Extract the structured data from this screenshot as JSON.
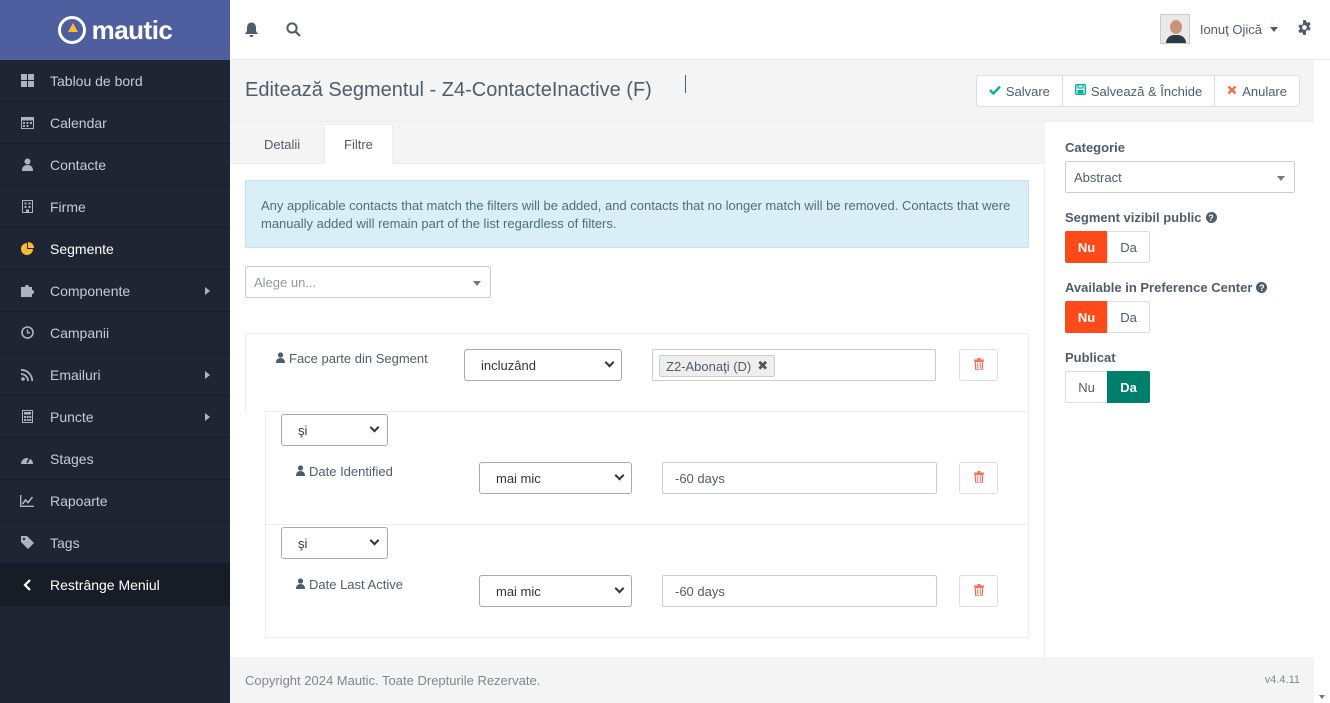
{
  "brand": {
    "name": "mautic",
    "accent": "#fdb933",
    "sidebar_bg": "#1f2532",
    "header_bg": "#4e5e9e"
  },
  "sidebar": {
    "items": [
      {
        "label": "Tablou de bord",
        "icon": "dashboard-icon"
      },
      {
        "label": "Calendar",
        "icon": "calendar-icon"
      },
      {
        "label": "Contacte",
        "icon": "user-icon"
      },
      {
        "label": "Firme",
        "icon": "building-icon"
      },
      {
        "label": "Segmente",
        "icon": "pie-chart-icon",
        "active": true
      },
      {
        "label": "Componente",
        "icon": "puzzle-icon",
        "has_submenu": true
      },
      {
        "label": "Campanii",
        "icon": "clock-icon"
      },
      {
        "label": "Emailuri",
        "icon": "rss-icon",
        "has_submenu": true
      },
      {
        "label": "Puncte",
        "icon": "calculator-icon",
        "has_submenu": true
      },
      {
        "label": "Stages",
        "icon": "tachometer-icon"
      },
      {
        "label": "Rapoarte",
        "icon": "line-chart-icon"
      },
      {
        "label": "Tags",
        "icon": "tag-icon"
      }
    ],
    "collapse_label": "Restrânge Meniul"
  },
  "header": {
    "user_name": "Ionuţ Ojică"
  },
  "page": {
    "title": "Editează Segmentul - Z4-ContacteInactive (F)",
    "buttons": {
      "save": "Salvare",
      "save_close": "Salvează & Închide",
      "cancel": "Anulare"
    }
  },
  "tabs": {
    "details": "Detalii",
    "filters": "Filtre"
  },
  "filters": {
    "info": "Any applicable contacts that match the filters will be added, and contacts that no longer match will be removed. Contacts that were manually added will remain part of the list regardless of filters.",
    "chooser_placeholder": "Alege un...",
    "rows": [
      {
        "label": "Face parte din Segment",
        "operator": "incluzând",
        "value": "Z2-Abonaţi (D)"
      },
      {
        "glue": "şi",
        "label": "Date Identified",
        "operator": "mai mic",
        "value": "-60 days"
      },
      {
        "glue": "şi",
        "label": "Date Last Active",
        "operator": "mai mic",
        "value": "-60 days"
      }
    ]
  },
  "right_panel": {
    "category_label": "Categorie",
    "category_value": "Abstract",
    "public_label": "Segment vizibil public",
    "preference_label": "Available in Preference Center",
    "published_label": "Publicat",
    "no": "Nu",
    "yes": "Da",
    "public_value": "Nu",
    "preference_value": "Nu",
    "published_value": "Da",
    "colors": {
      "no_active": "#fd4a1b",
      "yes_active": "#00806b"
    }
  },
  "footer": {
    "copyright": "Copyright 2024 Mautic. Toate Drepturile Rezervate.",
    "version": "v4.4.11"
  }
}
